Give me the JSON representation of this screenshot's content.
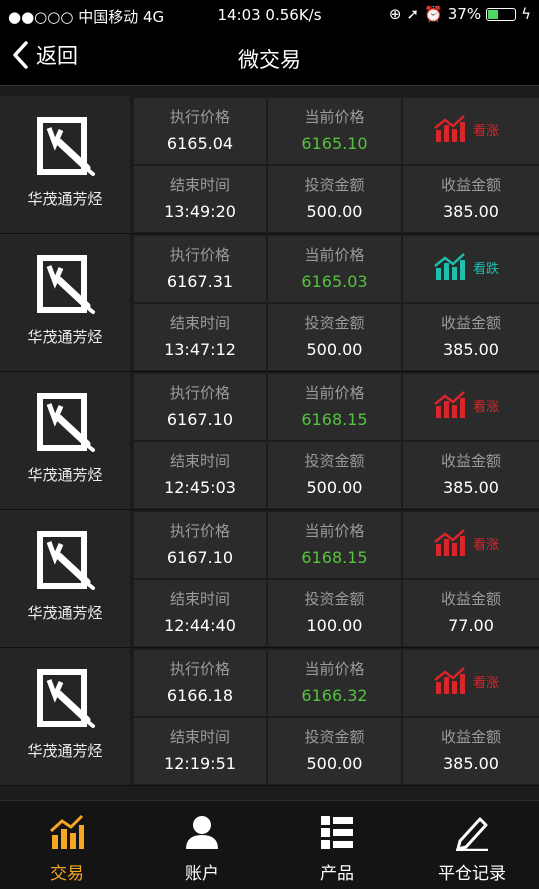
{
  "status": {
    "carrier": "●●○○○ 中国移动  4G",
    "time": "14:03 0.56K/s",
    "battery": "37%"
  },
  "nav": {
    "back_label": "返回",
    "title": "微交易"
  },
  "labels": {
    "exec_price": "执行价格",
    "current_price": "当前价格",
    "end_time": "结束时间",
    "investment": "投资金额",
    "profit": "收益金额"
  },
  "trades": [
    {
      "name": "华茂通芳烃",
      "exec_price": "6165.04",
      "current_price": "6165.10",
      "end_time": "13:49:20",
      "investment": "500.00",
      "profit": "385.00",
      "direction": "看涨",
      "dir_color": "#d8262b"
    },
    {
      "name": "华茂通芳烃",
      "exec_price": "6167.31",
      "current_price": "6165.03",
      "end_time": "13:47:12",
      "investment": "500.00",
      "profit": "385.00",
      "direction": "看跌",
      "dir_color": "#1fbfb0"
    },
    {
      "name": "华茂通芳烃",
      "exec_price": "6167.10",
      "current_price": "6168.15",
      "end_time": "12:45:03",
      "investment": "500.00",
      "profit": "385.00",
      "direction": "看涨",
      "dir_color": "#d8262b"
    },
    {
      "name": "华茂通芳烃",
      "exec_price": "6167.10",
      "current_price": "6168.15",
      "end_time": "12:44:40",
      "investment": "100.00",
      "profit": "77.00",
      "direction": "看涨",
      "dir_color": "#d8262b"
    },
    {
      "name": "华茂通芳烃",
      "exec_price": "6166.18",
      "current_price": "6166.32",
      "end_time": "12:19:51",
      "investment": "500.00",
      "profit": "385.00",
      "direction": "看涨",
      "dir_color": "#d8262b"
    }
  ],
  "tabs": [
    {
      "label": "交易",
      "icon": "chart-up-icon",
      "active": true
    },
    {
      "label": "账户",
      "icon": "user-icon",
      "active": false
    },
    {
      "label": "产品",
      "icon": "list-icon",
      "active": false
    },
    {
      "label": "平仓记录",
      "icon": "pen-icon",
      "active": false
    }
  ],
  "colors": {
    "accent": "#f6a623",
    "price_green": "#54c23d",
    "up_red": "#d8262b",
    "down_teal": "#1fbfb0"
  }
}
